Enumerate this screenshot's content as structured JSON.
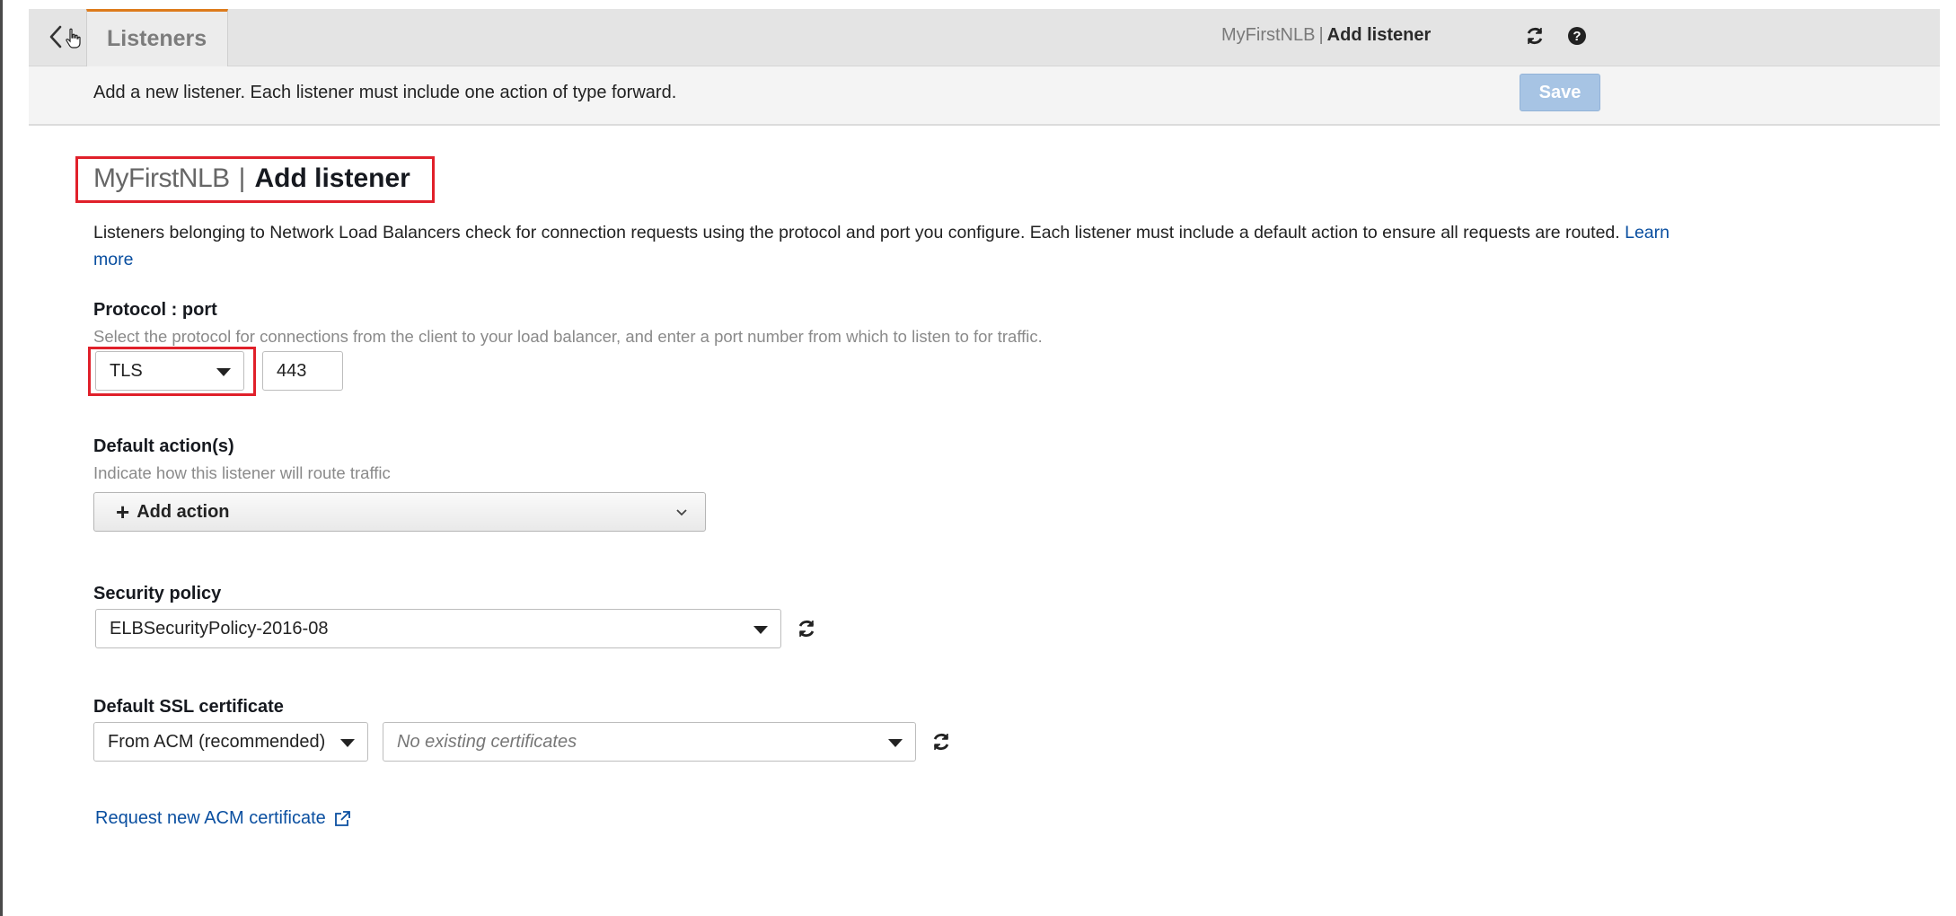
{
  "topbar": {
    "tab_label": "Listeners",
    "breadcrumb_lb": "MyFirstNLB",
    "breadcrumb_sep": "|",
    "breadcrumb_page": "Add listener",
    "icons": [
      "back-chevron-icon",
      "refresh-icon",
      "help-icon"
    ]
  },
  "infobar": {
    "message": "Add a new listener. Each listener must include one action of type forward.",
    "save_label": "Save"
  },
  "page": {
    "title_lb": "MyFirstNLB",
    "title_sep": "|",
    "title_action": "Add listener",
    "description": "Listeners belonging to Network Load Balancers check for connection requests using the protocol and port you configure. Each listener must include a default action to ensure all requests are routed.",
    "learn_more": "Learn more"
  },
  "protocol": {
    "label": "Protocol : port",
    "hint": "Select the protocol for connections from the client to your load balancer, and enter a port number from which to listen to for traffic.",
    "selected": "TLS",
    "port": "443"
  },
  "default_action": {
    "label": "Default action(s)",
    "hint": "Indicate how this listener will route traffic",
    "button_label": "Add action"
  },
  "security_policy": {
    "label": "Security policy",
    "selected": "ELBSecurityPolicy-2016-08"
  },
  "ssl_certificate": {
    "label": "Default SSL certificate",
    "source_selected": "From ACM (recommended)",
    "certificate_placeholder": "No existing certificates",
    "request_link": "Request new ACM certificate"
  },
  "colors": {
    "accent_tab": "#dd7b1c",
    "highlight_box": "#e0202a",
    "link": "#0a4fa0",
    "save_disabled": "#a7c4e4"
  }
}
